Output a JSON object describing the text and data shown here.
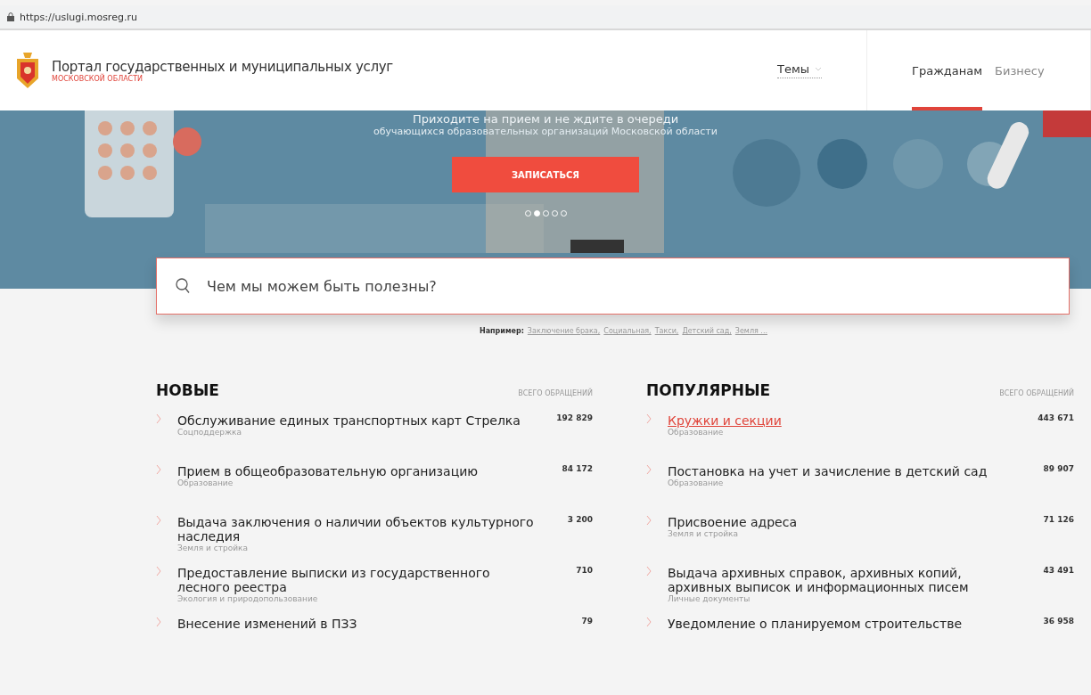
{
  "address_bar": {
    "url": "https://uslugi.mosreg.ru"
  },
  "header": {
    "title": "Портал государственных и муниципальных услуг",
    "subtitle": "МОСКОВСКОЙ ОБЛАСТИ",
    "topics": "Темы",
    "tabs": [
      {
        "label": "Гражданам",
        "selected": true
      },
      {
        "label": "Бизнесу",
        "selected": false
      }
    ]
  },
  "banner": {
    "headline": "Приходите на прием и не ждите в очереди",
    "caption": "обучающихся образовательных организаций Московской области",
    "button": "ЗАПИСАТЬСЯ",
    "dots": [
      {
        "selected": false
      },
      {
        "selected": true
      },
      {
        "selected": false
      },
      {
        "selected": false
      },
      {
        "selected": false
      }
    ]
  },
  "search": {
    "placeholder": "Чем мы можем быть полезны?"
  },
  "examples": {
    "label": "Например:",
    "links": [
      "Заключение брака,",
      "Социальная,",
      "Такси,",
      "Детский сад,",
      "Земля ..."
    ]
  },
  "columns": [
    {
      "title": "НОВЫЕ",
      "count_label": "ВСЕГО ОБРАЩЕНИЙ",
      "items": [
        {
          "title": "Обслуживание единых транспортных карт Стрелка",
          "category": "Соцподдержка",
          "count": "192 829",
          "highlighted": false
        },
        {
          "title": "Прием в общеобразовательную организацию",
          "category": "Образование",
          "count": "84 172",
          "highlighted": false
        },
        {
          "title": "Выдача заключения о наличии объектов культурного наследия",
          "category": "Земля и стройка",
          "count": "3 200",
          "highlighted": false
        },
        {
          "title": "Предоставление выписки из государственного лесного реестра",
          "category": "Экология и природопользование",
          "count": "710",
          "highlighted": false
        },
        {
          "title": "Внесение изменений в ПЗЗ",
          "count": "79",
          "highlighted": false
        }
      ]
    },
    {
      "title": "ПОПУЛЯРНЫЕ",
      "count_label": "ВСЕГО ОБРАЩЕНИЙ",
      "items": [
        {
          "title": "Кружки и секции",
          "category": "Образование",
          "count": "443 671",
          "highlighted": true
        },
        {
          "title": "Постановка на учет и зачисление в детский сад",
          "category": "Образование",
          "count": "89 907",
          "highlighted": false
        },
        {
          "title": "Присвоение адреса",
          "category": "Земля и стройка",
          "count": "71 126",
          "highlighted": false
        },
        {
          "title": "Выдача архивных справок, архивных копий, архивных выписок и информационных писем",
          "category": "Личные документы",
          "count": "43 491",
          "highlighted": false
        },
        {
          "title": "Уведомление о планируемом строительстве",
          "count": "36 958",
          "highlighted": false
        }
      ]
    }
  ]
}
